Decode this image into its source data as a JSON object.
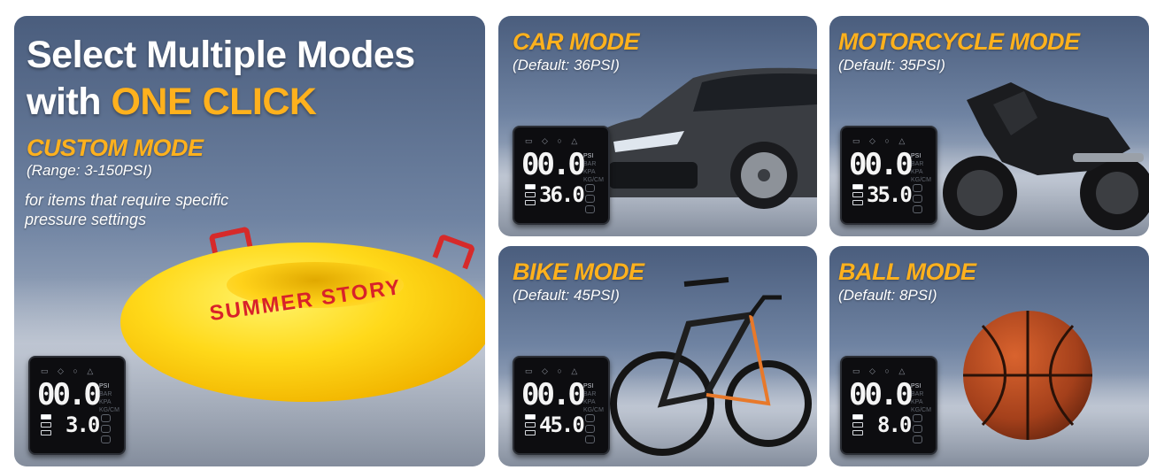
{
  "headline": {
    "line1": "Select Multiple Modes",
    "line2_prefix": "with ",
    "line2_accent": "ONE CLICK"
  },
  "custom": {
    "title": "CUSTOM MODE",
    "range": "(Range: 3-150PSI)",
    "desc_line1": "for items that require specific",
    "desc_line2": "pressure settings",
    "ring_text": "SUMMER STORY",
    "gauge": {
      "main": "00.0",
      "set": "3.0"
    }
  },
  "car": {
    "title": "CAR MODE",
    "default": "(Default: 36PSI)",
    "gauge": {
      "main": "00.0",
      "set": "36.0"
    }
  },
  "motorcycle": {
    "title": "MOTORCYCLE MODE",
    "default": "(Default: 35PSI)",
    "gauge": {
      "main": "00.0",
      "set": "35.0"
    }
  },
  "bike": {
    "title": "BIKE MODE",
    "default": "(Default: 45PSI)",
    "gauge": {
      "main": "00.0",
      "set": "45.0"
    }
  },
  "ball": {
    "title": "BALL MODE",
    "default": "(Default: 8PSI)",
    "gauge": {
      "main": "00.0",
      "set": "8.0"
    }
  },
  "gauge_labels": {
    "unit1": "PSI",
    "unit2": "BAR",
    "unit3": "KPA",
    "unit4": "KG/CM"
  },
  "colors": {
    "accent": "#ffb11d",
    "card_top": "#4a5d7d",
    "gauge_bg": "#0d0d10"
  }
}
